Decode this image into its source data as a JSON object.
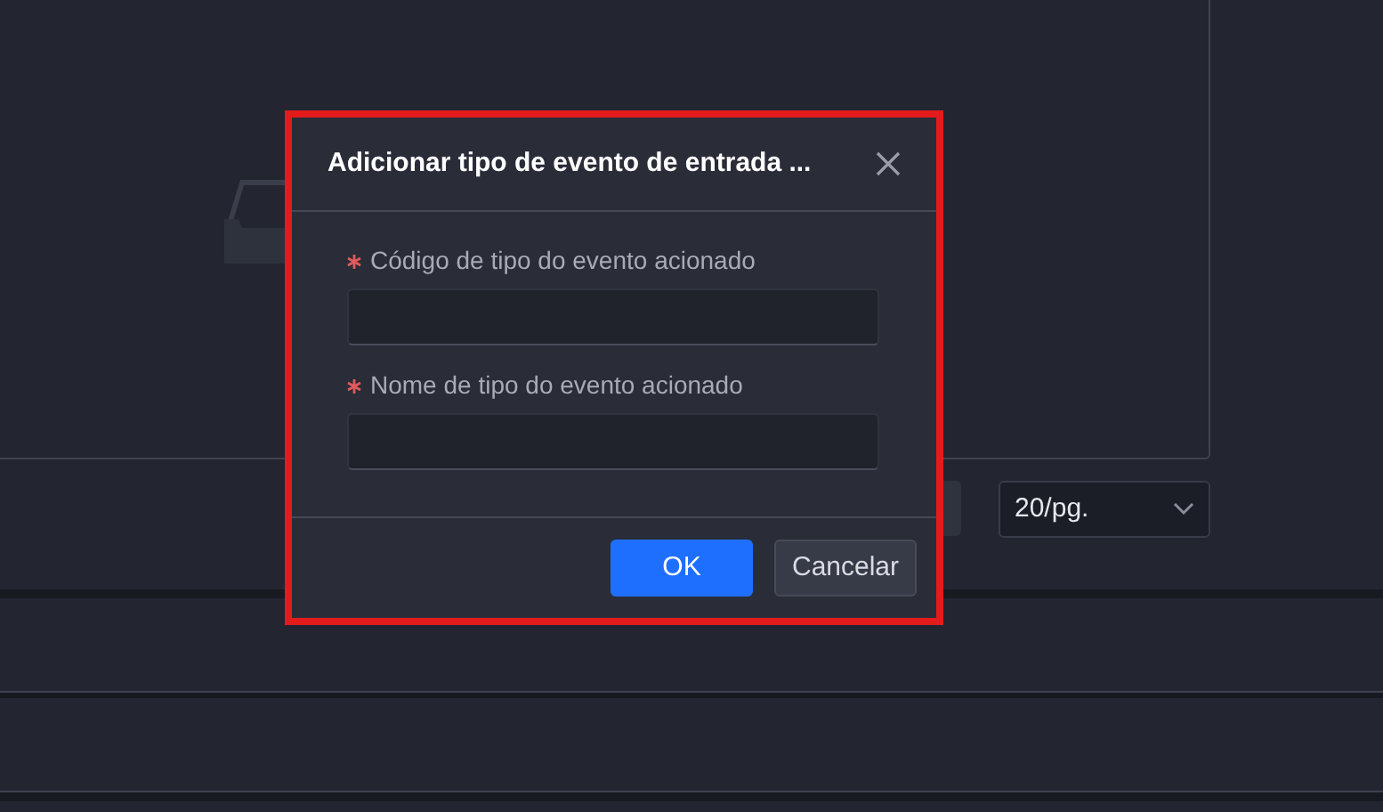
{
  "pagination": {
    "page_size": "20/pg."
  },
  "dialog": {
    "title": "Adicionar tipo de evento de entrada ...",
    "highlighted": true,
    "fields": [
      {
        "label": "Código de tipo do evento acionado",
        "required": true
      },
      {
        "label": "Nome de tipo do evento acionado",
        "required": true
      }
    ],
    "buttons": [
      {
        "label": "OK",
        "kind": "primary"
      },
      {
        "label": "Cancelar",
        "kind": "secondary"
      }
    ]
  }
}
